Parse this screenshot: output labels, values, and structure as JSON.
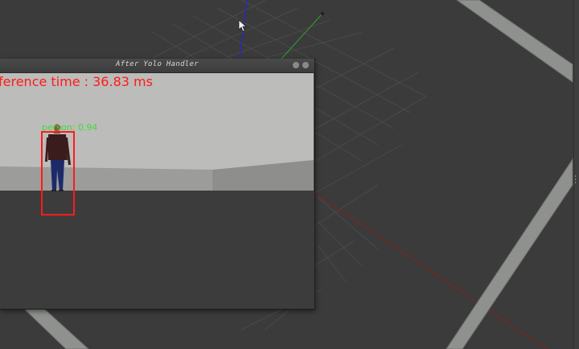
{
  "window": {
    "title": "After Yolo Handler",
    "inference_text": "ference time : 36.83 ms",
    "detection_label": "person: 0.94"
  },
  "viewport": {
    "grid": true,
    "axes": [
      "x",
      "y",
      "z"
    ]
  },
  "colors": {
    "background": "#3b3b3b",
    "grid": "#4a4a4a",
    "beam": "#8e918d",
    "box": "#ff1a1a",
    "label": "#3cdc3c",
    "x_axis": "#a02020",
    "y_axis": "#2ea02e",
    "z_axis": "#2a2ab4"
  },
  "icons": {
    "cursor": "cursor-arrow-icon"
  }
}
